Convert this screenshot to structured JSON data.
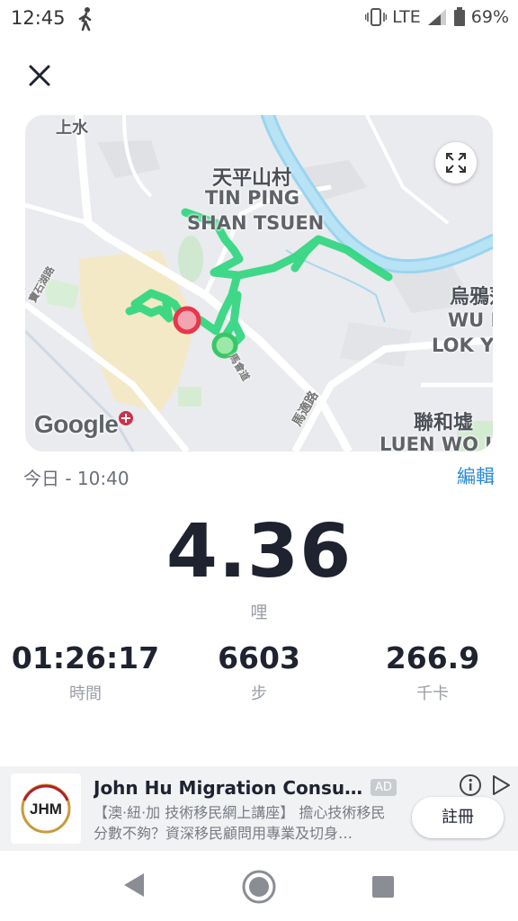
{
  "status_bar": {
    "time": "12:45",
    "network": "LTE",
    "battery": "69%",
    "icons": [
      "walk-icon",
      "vibrate-icon",
      "signal-icon",
      "battery-icon"
    ]
  },
  "header": {
    "close_icon": "close-icon"
  },
  "map": {
    "labels": {
      "sheung_shui": "上水",
      "tin_ping_zh": "天平山村",
      "tin_ping_en1": "TIN PING",
      "tin_ping_en2": "SHAN TSUEN",
      "wu_zh": "烏鴉落",
      "wu_en1": "WU N",
      "wu_en2": "LOK YI",
      "luen_zh": "聯和墟",
      "luen_en": "LUEN WO H",
      "road_1": "寶石湖路",
      "road_2": "馬適路",
      "road_3": "馬會道"
    },
    "google_logo": "Google",
    "expand_icon": "expand-icon",
    "route_color": "#2fd67f",
    "start_marker_color": "#43d16b",
    "end_marker_color": "#e8364a"
  },
  "activity": {
    "date": "今日 - 10:40",
    "edit_label": "編輯",
    "distance": "4.36",
    "distance_unit": "哩",
    "duration": "01:26:17",
    "duration_label": "時間",
    "steps": "6603",
    "steps_label": "步",
    "calories": "266.9",
    "calories_label": "千卡"
  },
  "ad": {
    "logo_text": "JHM",
    "title": "John Hu Migration Consultin…",
    "badge": "AD",
    "body": "【澳·紐·加 技術移民網上講座】 擔心技術移民分數不夠？資深移民顧問用專業及切身…",
    "cta": "註冊"
  },
  "nav": {
    "back_icon": "back-icon",
    "home_icon": "home-icon",
    "recents_icon": "recents-icon"
  }
}
